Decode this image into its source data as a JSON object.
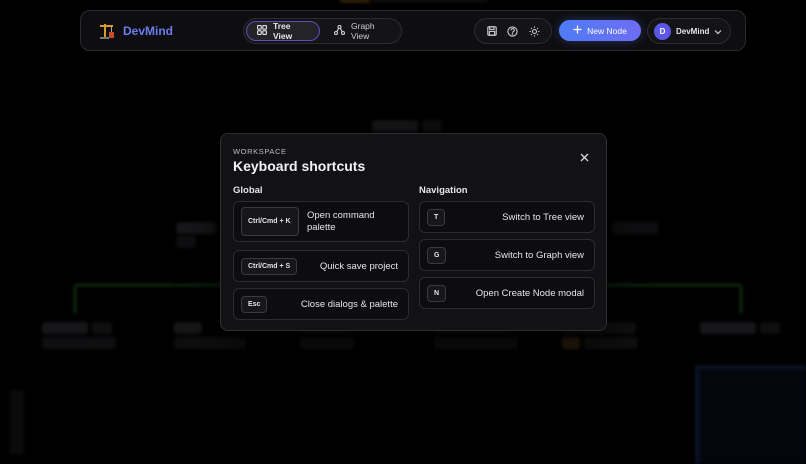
{
  "app": {
    "brand": "DevMind",
    "accent": "#6c7bf2",
    "button_gradient": [
      "#4f7cf5",
      "#6d6cf2"
    ]
  },
  "header": {
    "views": [
      {
        "label": "Tree View",
        "icon": "grid-icon",
        "active": true
      },
      {
        "label": "Graph View",
        "icon": "graph-nodes-icon",
        "active": false
      }
    ],
    "icons": [
      "save-icon",
      "help-icon",
      "sun-icon"
    ],
    "new_node_label": "New Node",
    "user": {
      "initial": "D",
      "name": "DevMind"
    }
  },
  "modal": {
    "eyebrow": "WORKSPACE",
    "title": "Keyboard shortcuts",
    "close_icon": "close-icon",
    "global": {
      "title": "Global",
      "shortcuts": [
        {
          "keys": "Ctrl/Cmd + K",
          "description": "Open command palette"
        },
        {
          "keys": "Ctrl/Cmd + S",
          "description": "Quick save project"
        },
        {
          "keys": "Esc",
          "description": "Close dialogs & palette"
        }
      ]
    },
    "navigation": {
      "title": "Navigation",
      "shortcuts": [
        {
          "keys": "T",
          "description": "Switch to Tree view"
        },
        {
          "keys": "G",
          "description": "Switch to Graph view"
        },
        {
          "keys": "N",
          "description": "Open Create Node modal"
        }
      ]
    }
  }
}
